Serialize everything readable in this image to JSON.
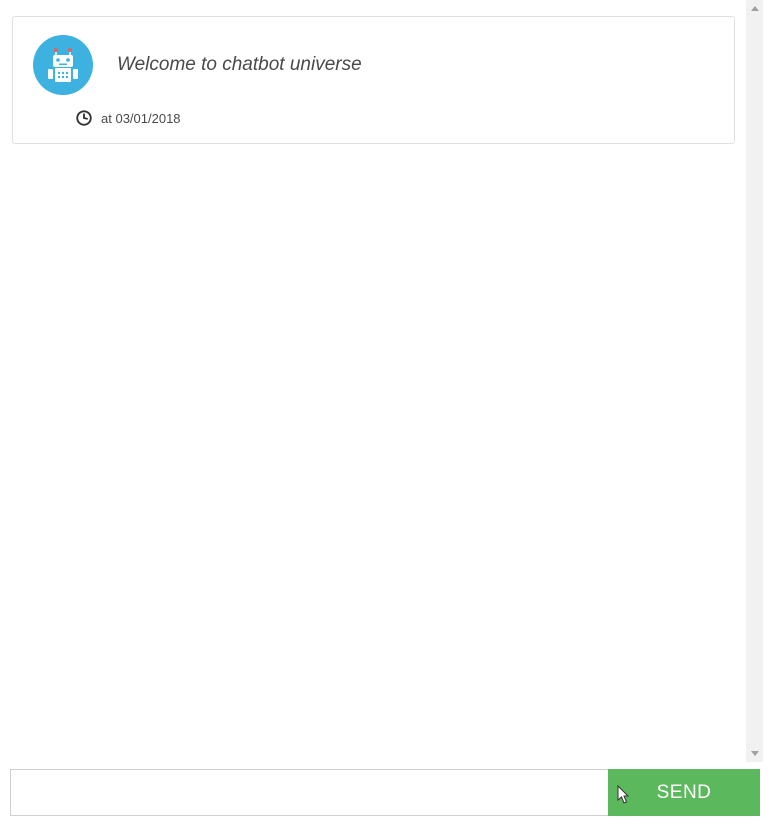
{
  "message": {
    "text": "Welcome to chatbot universe",
    "timestamp_prefix": "at ",
    "timestamp": "03/01/2018"
  },
  "input": {
    "placeholder": "",
    "value": ""
  },
  "send_button": {
    "label": "SEND"
  }
}
